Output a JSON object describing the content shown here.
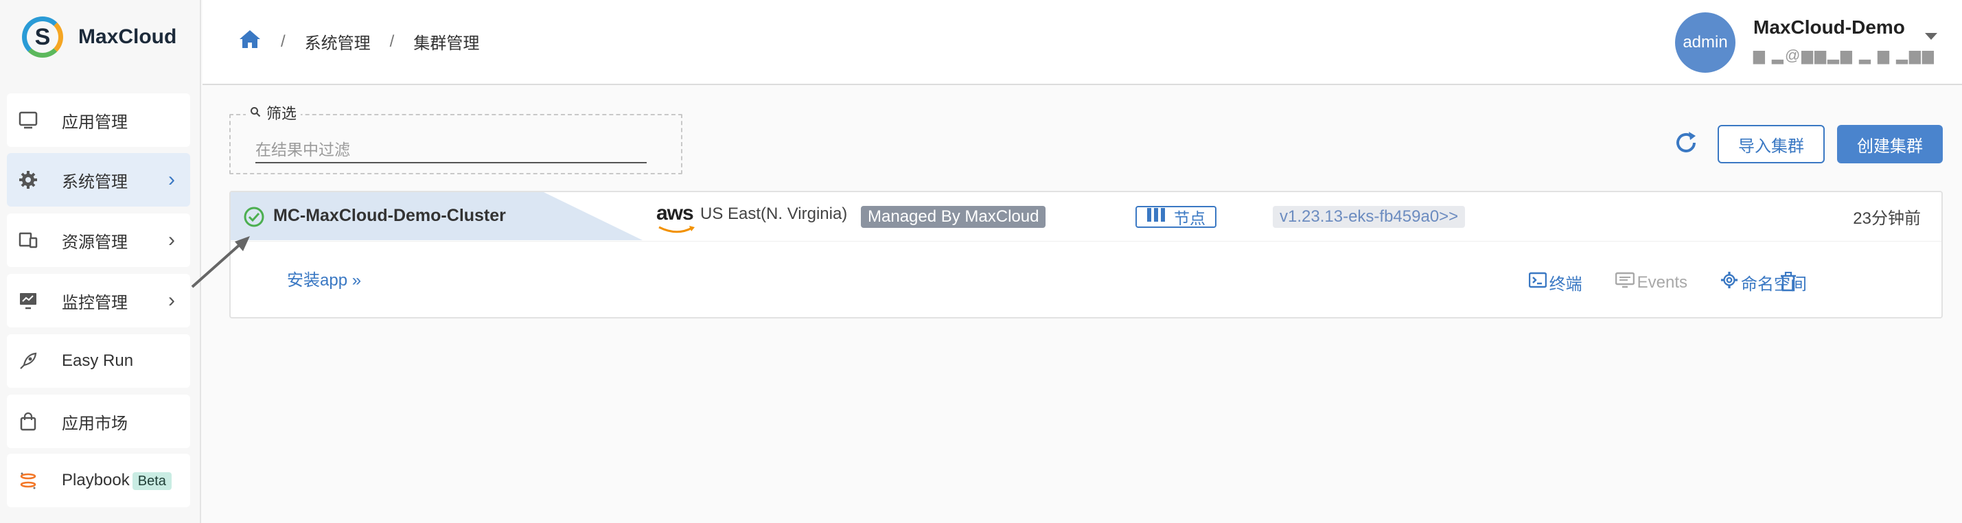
{
  "app": {
    "logo_letter": "S",
    "brand": "MaxCloud"
  },
  "sidebar": {
    "items": [
      {
        "label": "应用管理",
        "icon": "monitor-icon",
        "has_arrow": false
      },
      {
        "label": "系统管理",
        "icon": "gear-icon",
        "has_arrow": true,
        "active": true
      },
      {
        "label": "资源管理",
        "icon": "devices-icon",
        "has_arrow": true
      },
      {
        "label": "监控管理",
        "icon": "monitor-chart-icon",
        "has_arrow": true
      },
      {
        "label": "Easy Run",
        "icon": "rocket-icon",
        "has_arrow": false
      },
      {
        "label": "应用市场",
        "icon": "shopping-bag-icon",
        "has_arrow": false
      },
      {
        "label": "Playbook",
        "icon": "jupyter-icon",
        "badge": "Beta"
      }
    ],
    "arrow": "›"
  },
  "header": {
    "breadcrumb": [
      "系统管理",
      "集群管理"
    ],
    "separator": "/",
    "user": {
      "avatar": "admin",
      "name": "MaxCloud-Demo",
      "email": "▆ ▂@▆▆▂▆ ▂ ▆ ▂▆▆"
    }
  },
  "filter": {
    "legend": "筛选",
    "placeholder": "在结果中过滤",
    "value": ""
  },
  "toolbar": {
    "import_label": "导入集群",
    "create_label": "创建集群"
  },
  "cluster": {
    "name": "MC-MaxCloud-Demo-Cluster",
    "status": "running",
    "provider": "aws",
    "region": "US East(N. Virginia)",
    "managed_badge": "Managed By MaxCloud",
    "nodes_label": "节点",
    "version": "v1.23.13-eks-fb459a0>>",
    "age": "23分钟前",
    "install_link": "安装app »",
    "actions": [
      {
        "label": "终端",
        "icon": "terminal-icon",
        "enabled": true
      },
      {
        "label": "Events",
        "icon": "events-icon",
        "enabled": false
      },
      {
        "label": "命名空间",
        "icon": "gear-icon",
        "enabled": true
      }
    ]
  },
  "colors": {
    "accent": "#3a78c3",
    "primary_button": "#4a84cd",
    "ribbon": "#dbe6f3",
    "status_ok": "#4caf50"
  }
}
